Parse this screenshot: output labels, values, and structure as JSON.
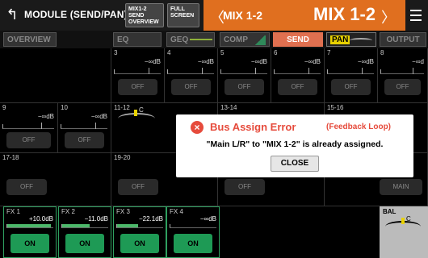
{
  "header": {
    "title": "MODULE (SEND/PAN)",
    "send_overview_label": "MIX1-2 SEND OVERVIEW",
    "full_screen_label": "FULL SCREEN",
    "mix_small": "MIX 1-2",
    "mix_big": "MIX 1-2",
    "accent": "#e06f1f"
  },
  "tabs": {
    "overview": "OVERVIEW",
    "eq": "EQ",
    "geq": "GEQ",
    "comp": "COMP",
    "send": "SEND",
    "pan": "PAN",
    "output": "OUTPUT"
  },
  "channels_row1": [
    {
      "num": "3",
      "db": "−∞dB",
      "off": "OFF"
    },
    {
      "num": "4",
      "db": "−∞dB",
      "off": "OFF"
    },
    {
      "num": "5",
      "db": "−∞dB",
      "off": "OFF"
    },
    {
      "num": "6",
      "db": "−∞dB",
      "off": "OFF"
    },
    {
      "num": "7",
      "db": "−∞dB",
      "off": "OFF"
    },
    {
      "num": "8",
      "db": "−∞d",
      "off": "OFF"
    }
  ],
  "channels_row2": [
    {
      "num": "9",
      "db": "−∞dB",
      "off": "OFF"
    },
    {
      "num": "10",
      "db": "−∞dB",
      "off": "OFF"
    },
    {
      "num": "11-12",
      "pan": "C"
    },
    {
      "num": "13-14"
    },
    {
      "num": "15-16"
    }
  ],
  "channels_row3": [
    {
      "num": "17-18",
      "off": "OFF"
    },
    {
      "num": "19-20",
      "off": "OFF"
    },
    {
      "off": "OFF"
    },
    {
      "main": "MAIN"
    }
  ],
  "fx": [
    {
      "num": "FX 1",
      "db": "+10.0dB",
      "on": "ON",
      "level": 0.95
    },
    {
      "num": "FX 2",
      "db": "−11.0dB",
      "on": "ON",
      "level": 0.6
    },
    {
      "num": "FX 3",
      "db": "−22.1dB",
      "on": "ON",
      "level": 0.45
    },
    {
      "num": "FX 4",
      "db": "−∞dB",
      "on": "ON",
      "level": 0
    }
  ],
  "bal": {
    "label": "BAL",
    "center": "C"
  },
  "dialog": {
    "title": "Bus Assign Error",
    "subtitle": "(Feedback Loop)",
    "message": "\"Main L/R\" to \"MIX 1-2\" is already assigned.",
    "close": "CLOSE",
    "icon": "error-x-icon"
  }
}
